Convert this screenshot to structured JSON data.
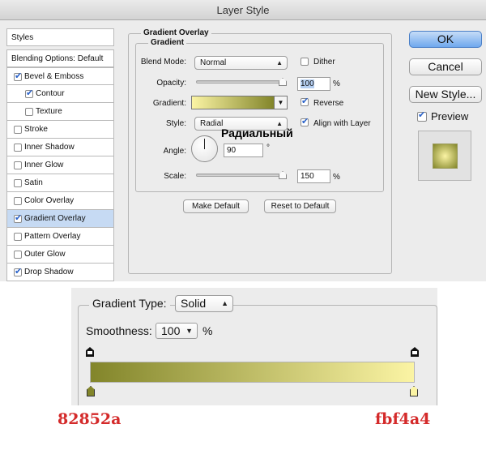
{
  "dialog": {
    "title": "Layer Style",
    "sidebar": {
      "styles_header": "Styles",
      "blending_options": "Blending Options: Default",
      "items": [
        {
          "label": "Bevel & Emboss",
          "checked": true
        },
        {
          "label": "Contour",
          "checked": true
        },
        {
          "label": "Texture",
          "checked": false
        },
        {
          "label": "Stroke",
          "checked": false
        },
        {
          "label": "Inner Shadow",
          "checked": false
        },
        {
          "label": "Inner Glow",
          "checked": false
        },
        {
          "label": "Satin",
          "checked": false
        },
        {
          "label": "Color Overlay",
          "checked": false
        },
        {
          "label": "Gradient Overlay",
          "checked": true,
          "active": true
        },
        {
          "label": "Pattern Overlay",
          "checked": false
        },
        {
          "label": "Outer Glow",
          "checked": false
        },
        {
          "label": "Drop Shadow",
          "checked": true
        }
      ]
    },
    "panel": {
      "section_title": "Gradient Overlay",
      "group_title": "Gradient",
      "blend_mode_label": "Blend Mode:",
      "blend_mode_value": "Normal",
      "dither_label": "Dither",
      "dither_checked": false,
      "opacity_label": "Opacity:",
      "opacity_value": "100",
      "opacity_unit": "%",
      "gradient_label": "Gradient:",
      "reverse_label": "Reverse",
      "reverse_checked": true,
      "style_label": "Style:",
      "style_value": "Radial",
      "align_label": "Align with Layer",
      "align_checked": true,
      "annotation": "Радиальный",
      "angle_label": "Angle:",
      "angle_value": "90",
      "angle_unit": "°",
      "scale_label": "Scale:",
      "scale_value": "150",
      "scale_unit": "%",
      "make_default": "Make Default",
      "reset_default": "Reset to Default"
    },
    "buttons": {
      "ok": "OK",
      "cancel": "Cancel",
      "new_style": "New Style...",
      "preview_label": "Preview",
      "preview_checked": true
    }
  },
  "gradient_editor": {
    "type_label": "Gradient Type:",
    "type_value": "Solid",
    "smoothness_label": "Smoothness:",
    "smoothness_value": "100",
    "smoothness_unit": "%"
  },
  "colors": {
    "left_hex": "82852a",
    "right_hex": "fbf4a4",
    "left_color": "#82852a",
    "right_color": "#fbf4a4",
    "annotation_red": "#d42a2a",
    "accent_blue": "#2a62c9"
  }
}
